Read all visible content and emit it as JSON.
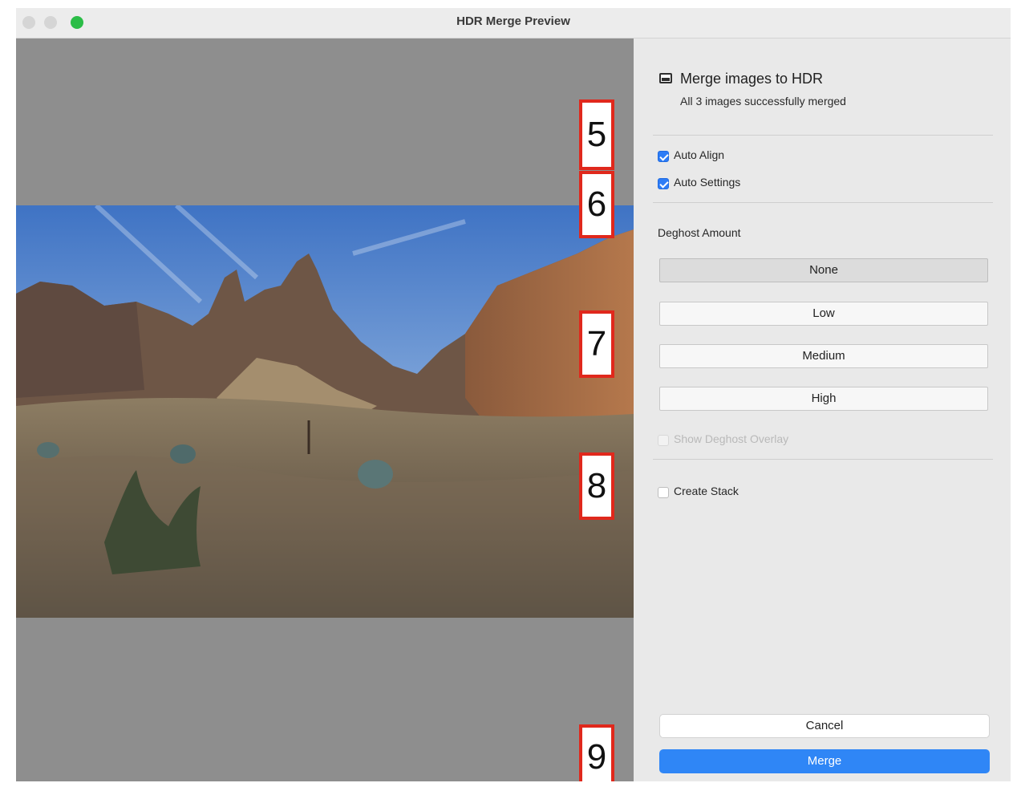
{
  "window": {
    "title": "HDR Merge Preview"
  },
  "panel": {
    "heading": "Merge images to HDR",
    "subheading": "All 3 images successfully merged",
    "options": {
      "auto_align": {
        "label": "Auto Align",
        "checked": true
      },
      "auto_settings": {
        "label": "Auto Settings",
        "checked": true
      }
    },
    "deghost": {
      "label": "Deghost Amount",
      "options": [
        "None",
        "Low",
        "Medium",
        "High"
      ],
      "selected": "None",
      "overlay": {
        "label": "Show Deghost Overlay",
        "checked": false,
        "enabled": false
      }
    },
    "create_stack": {
      "label": "Create Stack",
      "checked": false
    },
    "buttons": {
      "cancel": "Cancel",
      "merge": "Merge"
    }
  },
  "callouts": [
    "5",
    "6",
    "7",
    "8",
    "9"
  ],
  "colors": {
    "accent": "#2f86f6",
    "callout_border": "#e0281c",
    "preview_bg": "#8e8e8e"
  }
}
